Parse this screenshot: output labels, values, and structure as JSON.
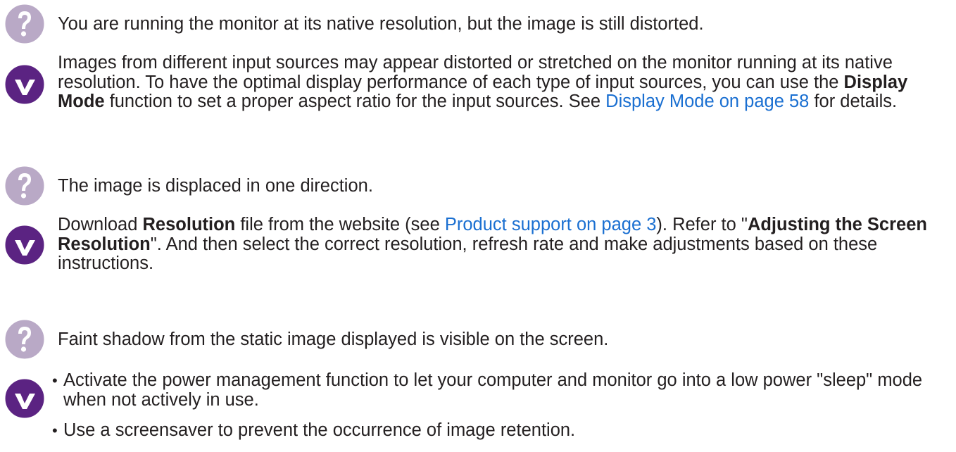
{
  "colors": {
    "question_circle": "#b9a9c6",
    "question_mark": "#ffffff",
    "check_circle": "#5b2382",
    "check_mark": "#ffffff",
    "link": "#1a6fd1",
    "text": "#231f20"
  },
  "items": [
    {
      "question_icon": "question-icon",
      "question": "You are running the monitor at its native resolution, but the image is still distorted.",
      "answer_icon": "check-icon",
      "answer": {
        "t1": "Images from different input sources may appear distorted or stretched on the monitor running at its native resolution. To have the optimal display performance of each type of input sources, you can use the ",
        "b1": "Display Mode",
        "t2": " function to set a proper aspect ratio for the input sources. See ",
        "link": "Display Mode on page 58",
        "t3": " for details."
      }
    },
    {
      "question_icon": "question-icon",
      "question": "The image is displaced in one direction.",
      "answer_icon": "check-icon",
      "answer": {
        "t1": "Download ",
        "b1": "Resolution",
        "t2": " file from the website (see ",
        "link": "Product support on page 3",
        "t3": "). Refer to \"",
        "b2": "Adjusting the Screen Resolution",
        "t4": "\". And then select the correct resolution, refresh rate and make adjustments based on these instructions."
      }
    },
    {
      "question_icon": "question-icon",
      "question": "Faint shadow from the static image displayed is visible on the screen.",
      "answer_icon": "check-icon",
      "bullets": [
        "Activate the power management function to let your computer and monitor go into a low power \"sleep\" mode when not actively in use.",
        "Use a screensaver to prevent the occurrence of image retention."
      ]
    }
  ]
}
